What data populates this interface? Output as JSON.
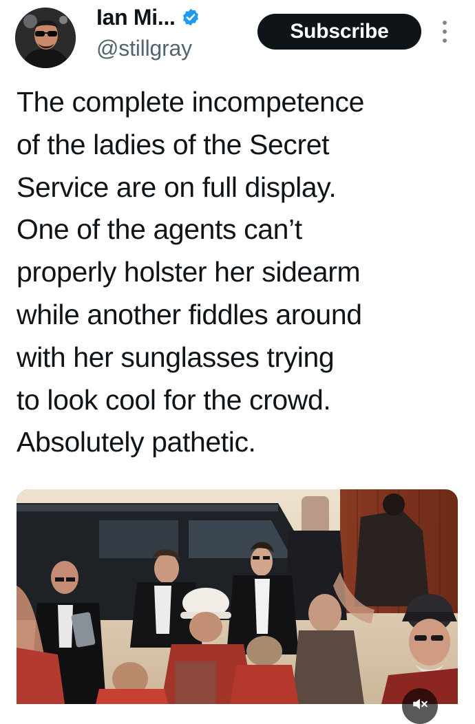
{
  "tweet": {
    "author": {
      "display_name": "Ian Mi...",
      "handle": "@stillgray",
      "verified": true,
      "avatar_icon": "profile-avatar"
    },
    "subscribe_label": "Subscribe",
    "more_icon": "more-vertical-icon",
    "text_lines": [
      "The complete incompetence",
      "of the ladies of the Secret",
      "Service are on full display.",
      "One of the agents can’t",
      "properly holster her sidearm",
      "while another fiddles around",
      "with her sunglasses trying",
      "to look cool for the crowd.",
      "Absolutely pathetic."
    ],
    "media": {
      "kind": "video",
      "volume_icon": "volume-muted-icon"
    }
  },
  "colors": {
    "text": "#0f1419",
    "secondary_text": "#536471",
    "verified": "#1d9bf0",
    "subscribe_bg": "#0f1419",
    "subscribe_text": "#ffffff"
  }
}
